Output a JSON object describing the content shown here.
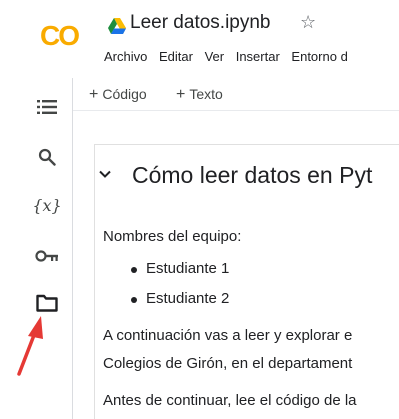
{
  "header": {
    "logo_text": "CO",
    "notebook_title": "Leer datos.ipynb",
    "star_glyph": "☆"
  },
  "menu": {
    "items": [
      "Archivo",
      "Editar",
      "Ver",
      "Insertar",
      "Entorno d"
    ]
  },
  "sidebar": {
    "icons": [
      "table-of-contents-icon",
      "search-icon",
      "variables-icon",
      "secrets-key-icon",
      "files-folder-icon"
    ],
    "variables_label": "{x}"
  },
  "toolbar": {
    "code_label": "Código",
    "text_label": "Texto",
    "plus": "+"
  },
  "notebook": {
    "heading": "Cómo leer datos en Pyt",
    "team_label": "Nombres del equipo:",
    "students": [
      "Estudiante 1",
      "Estudiante 2"
    ],
    "paragraph_line1": "A continuación vas a leer y explorar e",
    "paragraph_line2": "Colegios de Girón, en el departament",
    "paragraph_line3": "Antes de continuar, lee el código de la"
  },
  "colors": {
    "logo_yellow": "#f9ab00",
    "logo_orange": "#e37400",
    "annotation_arrow": "#e53935"
  }
}
